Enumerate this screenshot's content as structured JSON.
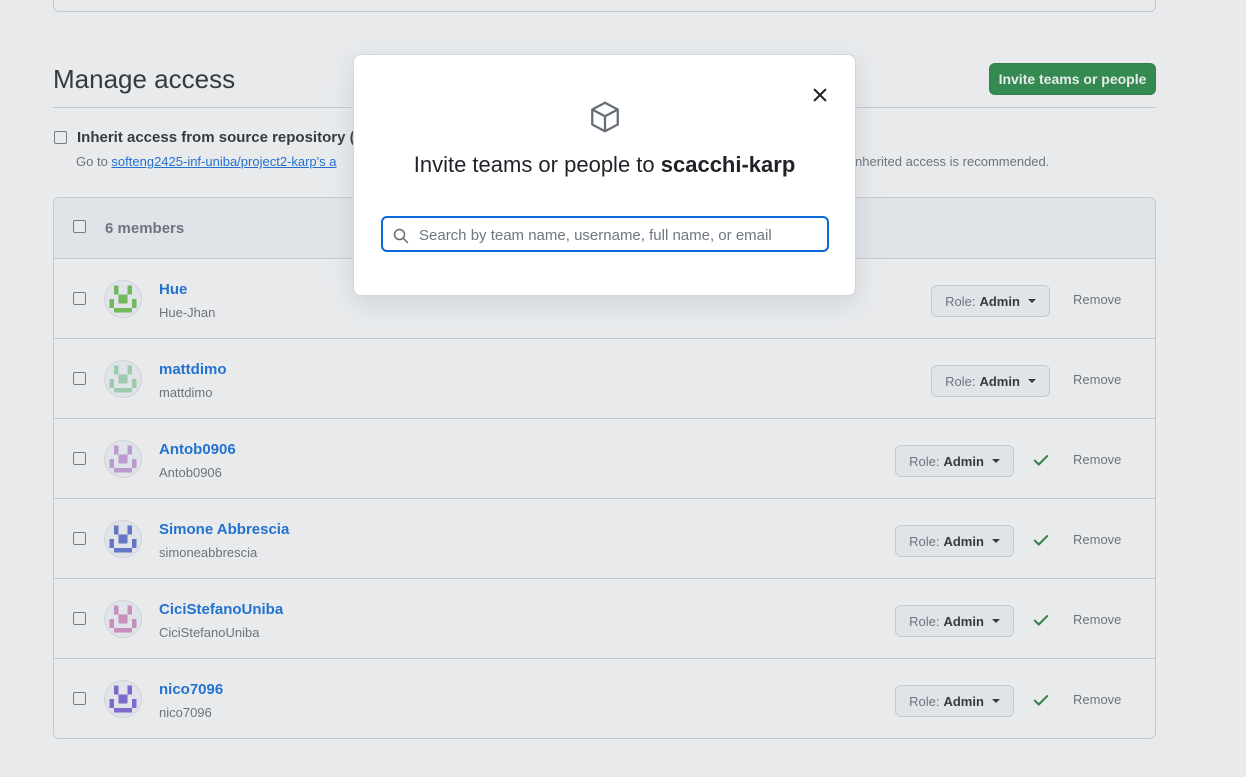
{
  "section": {
    "title": "Manage access",
    "invite_button": "Invite teams or people"
  },
  "inherit": {
    "label": "Inherit access from source repository (r",
    "help_prefix": "Go to ",
    "help_link": "softeng2425-inf-uniba/project2-karp's a",
    "help_suffix": "nherited access is recommended."
  },
  "members": {
    "count_label": "6 members",
    "items": [
      {
        "name": "Hue",
        "username": "Hue-Jhan",
        "role_prefix": "Role:",
        "role": "Admin",
        "confirmed": false,
        "remove": "Remove",
        "avatar_color": "#6cc24a"
      },
      {
        "name": "mattdimo",
        "username": "mattdimo",
        "role_prefix": "Role:",
        "role": "Admin",
        "confirmed": false,
        "remove": "Remove",
        "avatar_color": "#a3d9b1"
      },
      {
        "name": "Antob0906",
        "username": "Antob0906",
        "role_prefix": "Role:",
        "role": "Admin",
        "confirmed": true,
        "remove": "Remove",
        "avatar_color": "#c99bd9"
      },
      {
        "name": "Simone Abbrescia",
        "username": "simoneabbrescia",
        "role_prefix": "Role:",
        "role": "Admin",
        "confirmed": true,
        "remove": "Remove",
        "avatar_color": "#5b6fcf"
      },
      {
        "name": "CiciStefanoUniba",
        "username": "CiciStefanoUniba",
        "role_prefix": "Role:",
        "role": "Admin",
        "confirmed": true,
        "remove": "Remove",
        "avatar_color": "#d58ec6"
      },
      {
        "name": "nico7096",
        "username": "nico7096",
        "role_prefix": "Role:",
        "role": "Admin",
        "confirmed": true,
        "remove": "Remove",
        "avatar_color": "#7b5fd6"
      }
    ]
  },
  "modal": {
    "title_prefix": "Invite teams or people to ",
    "repo_name": "scacchi-karp",
    "search_placeholder": "Search by team name, username, full name, or email"
  },
  "colors": {
    "accent_green": "#1f883d",
    "link_blue": "#0969da",
    "check_green": "#1a7f37"
  }
}
